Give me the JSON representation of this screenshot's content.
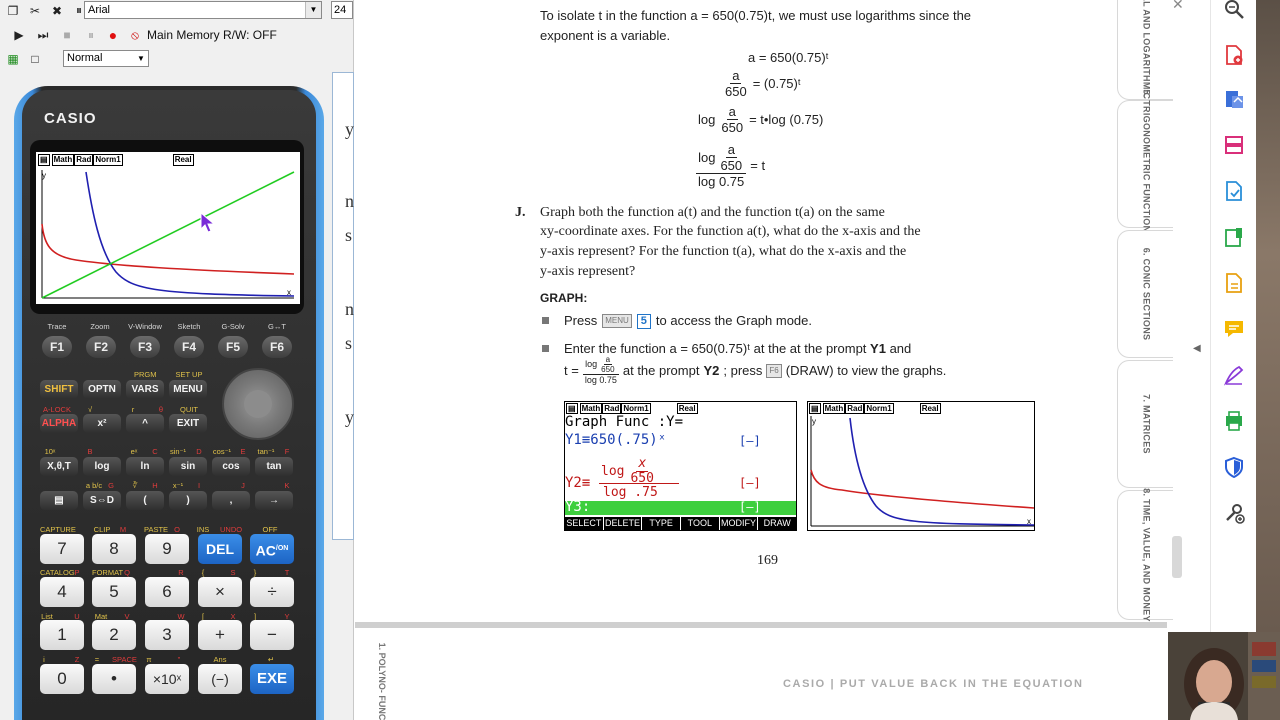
{
  "emulator": {
    "font_name": "Arial",
    "font_size": "24",
    "memory_status": "Main Memory R/W: OFF",
    "mode_select": "Normal",
    "calculator": {
      "brand": "CASIO",
      "lcd_status": [
        "Math",
        "Rad",
        "Norm1",
        "Real"
      ],
      "axis_y": "y",
      "axis_x": "x",
      "fn_labels": [
        "Trace",
        "Zoom",
        "V-Window",
        "Sketch",
        "G-Solv",
        "G↔T"
      ],
      "fn_keys": [
        "F1",
        "F2",
        "F3",
        "F4",
        "F5",
        "F6"
      ],
      "row1": [
        "SHIFT",
        "OPTN",
        "VARS",
        "MENU"
      ],
      "row1_top": [
        "PRGM",
        "SET UP"
      ],
      "row2": [
        "ALPHA",
        "x²",
        "^",
        "EXIT"
      ],
      "row2_top": [
        "A-LOCK",
        "√",
        "r",
        "θ",
        "QUIT"
      ],
      "row3": [
        "X,θ,T",
        "log",
        "ln",
        "sin",
        "cos",
        "tan"
      ],
      "row3_top": [
        "10ˣ",
        "B",
        "eˣ",
        "C",
        "sin⁻¹",
        "D",
        "cos⁻¹",
        "E",
        "tan⁻¹",
        "F"
      ],
      "row4": [
        "▤",
        "S⇔D",
        "(",
        ")",
        ",",
        "→"
      ],
      "row4_top": [
        "a b/c",
        "G",
        "∛",
        "H",
        "x⁻¹",
        "I",
        "J",
        "K",
        "L"
      ],
      "num_row1": [
        "7",
        "8",
        "9",
        "DEL",
        "AC"
      ],
      "num_row1_top": [
        "CAPTURE",
        "CLIP",
        "M",
        "PASTE",
        "O",
        "INS",
        "UNDO",
        "OFF"
      ],
      "num_row2": [
        "4",
        "5",
        "6",
        "×",
        "÷"
      ],
      "num_row2_top": [
        "CATALOG",
        "P",
        "FORMAT",
        "Q",
        "R",
        "{",
        "S",
        "}",
        "T"
      ],
      "num_row3": [
        "1",
        "2",
        "3",
        "+",
        "−"
      ],
      "num_row3_top": [
        "List",
        "U",
        "Mat",
        "V",
        "W",
        "[",
        "X",
        "]",
        "Y"
      ],
      "num_row4": [
        "0",
        "•",
        "×10ˣ",
        "(−)",
        "EXE"
      ],
      "num_row4_top": [
        "i",
        "Z",
        "=",
        "SPACE",
        "π",
        "\"",
        "Ans",
        "↵"
      ],
      "ac_sup": "/ON"
    },
    "side_fragment": [
      "y",
      "n",
      "s",
      "n",
      "s",
      "y"
    ]
  },
  "document": {
    "intro_line1": "To isolate t in the function a = 650(0.75)t, we must use logarithms since the",
    "intro_line2": "exponent is a variable.",
    "eq1": "a = 650(0.75)ᵗ",
    "eq2_num": "a",
    "eq2_den": "650",
    "eq2_rhs": "= (0.75)ᵗ",
    "eq3_log": "log",
    "eq3_rhs": "= t•log (0.75)",
    "eq4_top_log": "log",
    "eq4_bottom": "log 0.75",
    "eq4_rhs": "= t",
    "item_letter": "J.",
    "item_text": [
      "Graph both the function a(t) and the function t(a) on the same",
      "xy-coordinate axes. For the function a(t), what do the x-axis and the",
      "y-axis represent? For the function t(a), what do the x-axis and the",
      "y-axis represent?"
    ],
    "graph_heading": "GRAPH:",
    "bullet1_pre": "Press",
    "bullet1_menu": "MENU",
    "bullet1_key": "5",
    "bullet1_post": "to access the Graph mode.",
    "bullet2_line1_pre": "Enter the function a = 650(0.75)ᵗ at the at the prompt",
    "bullet2_line1_bold": "Y1",
    "bullet2_line1_post": "and",
    "bullet2_t": "t =",
    "bullet2_log": "log",
    "bullet2_den": "log 0.75",
    "bullet2_mid": "at the prompt",
    "bullet2_bold": "Y2",
    "bullet2_post": "; press",
    "bullet2_f6": "F6",
    "bullet2_end": "(DRAW) to view the graphs.",
    "shot1": {
      "header": "Graph Func  :Y=",
      "y1": "Y1≡650(.75)ˣ",
      "y2": "Y2≡",
      "y2_log1": "log",
      "y2_x": "x",
      "y2_650": "650",
      "y2_log2": "log .75",
      "y3": "Y3:",
      "style": "[—]",
      "menu": [
        "SELECT",
        "DELETE",
        "TYPE",
        "TOOL",
        "MODIFY",
        "DRAW"
      ]
    },
    "page_number": "169",
    "footer": "CASIO | PUT VALUE BACK IN THE EQUATION",
    "bottom_tab": "1. POLYNO- FUNCTIO"
  },
  "chapter_tabs": [
    "4. EXPONENTIAL AND LOGARITHMIC FUNCTIONS",
    "5. TRIGONOMETRIC FUNCTIONS",
    "6. CONIC SECTIONS",
    "7. MATRICES",
    "8. TIME, VALUE, AND MONEY"
  ],
  "right_toolbar": [
    "zoom-icon",
    "pdf-add-icon",
    "export-pdf-icon",
    "organize-pages-icon",
    "convert-pdf-icon",
    "edit-pdf-icon",
    "create-pdf-icon",
    "comment-icon",
    "fill-sign-icon",
    "print-production-icon",
    "protect-icon",
    "more-tools-icon"
  ],
  "colors": {
    "y1_curve": "#2020b0",
    "y2_curve": "#d02020",
    "line": "#22cc22",
    "casio_blue": "#1f73c7",
    "y3_highlight": "#3ecf3e"
  }
}
